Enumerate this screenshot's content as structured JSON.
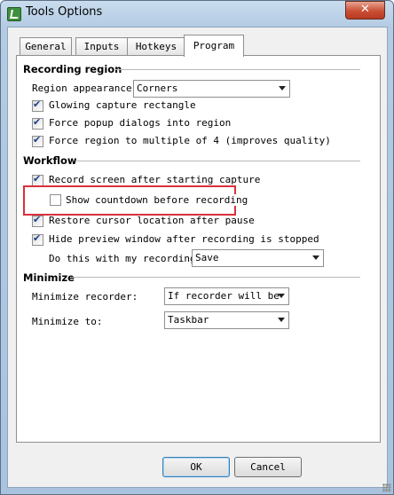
{
  "window": {
    "title": "Tools Options",
    "close_label": "✕"
  },
  "tabs": [
    {
      "label": "General",
      "active": false
    },
    {
      "label": "Inputs",
      "active": false
    },
    {
      "label": "Hotkeys",
      "active": false
    },
    {
      "label": "Program",
      "active": true
    }
  ],
  "recording_region": {
    "header": "Recording region",
    "appearance_label": "Region appearance:",
    "appearance_value": "Corners",
    "options": [
      {
        "label": "Glowing capture rectangle",
        "checked": true
      },
      {
        "label": "Force popup dialogs into region",
        "checked": true
      },
      {
        "label": "Force region to multiple of 4 (improves quality)",
        "checked": true
      }
    ]
  },
  "workflow": {
    "header": "Workflow",
    "options": [
      {
        "label": "Record screen after starting capture",
        "checked": true
      },
      {
        "label": "Show countdown before recording",
        "checked": false
      },
      {
        "label": "Restore cursor location after pause",
        "checked": true
      },
      {
        "label": "Hide preview window after recording is stopped",
        "checked": true
      }
    ],
    "do_this_label": "Do this with my recording:",
    "do_this_value": "Save",
    "highlight_color": "#d9303b"
  },
  "minimize": {
    "header": "Minimize",
    "recorder_label": "Minimize recorder:",
    "recorder_value": "If recorder will be",
    "to_label": "Minimize to:",
    "to_value": "Taskbar"
  },
  "buttons": {
    "ok": "OK",
    "cancel": "Cancel"
  },
  "colors": {
    "titlebar": "#b3cbe3",
    "close_button": "#c94f35",
    "check": "#1c3e8a"
  }
}
